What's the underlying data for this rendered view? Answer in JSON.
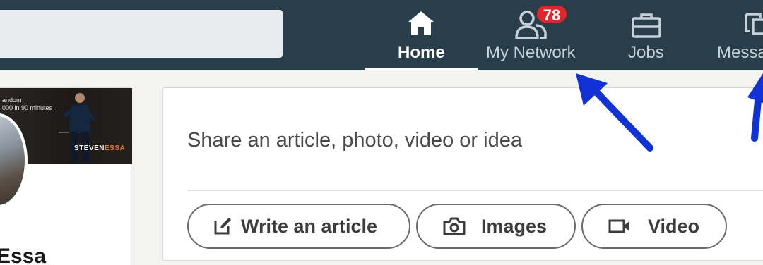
{
  "nav": {
    "items": [
      {
        "label": "Home",
        "icon": "home-icon"
      },
      {
        "label": "My Network",
        "icon": "people-icon",
        "badge": "78"
      },
      {
        "label": "Jobs",
        "icon": "briefcase-icon"
      },
      {
        "label": "Messa",
        "icon": "messaging-icon"
      }
    ]
  },
  "profile": {
    "banner_line1": "andom",
    "banner_line2": "000 in 90 minutes",
    "banner_brand_a": "STEVEN",
    "banner_brand_b": "ESSA",
    "name": "Essa"
  },
  "share": {
    "prompt": "Share an article, photo, video or idea",
    "actions": [
      {
        "label": "Write an article",
        "icon": "edit-icon"
      },
      {
        "label": "Images",
        "icon": "camera-icon"
      },
      {
        "label": "Video",
        "icon": "video-icon"
      }
    ]
  },
  "colors": {
    "nav_bg": "#283e4a",
    "badge": "#e0252b",
    "arrow": "#1133d6"
  }
}
